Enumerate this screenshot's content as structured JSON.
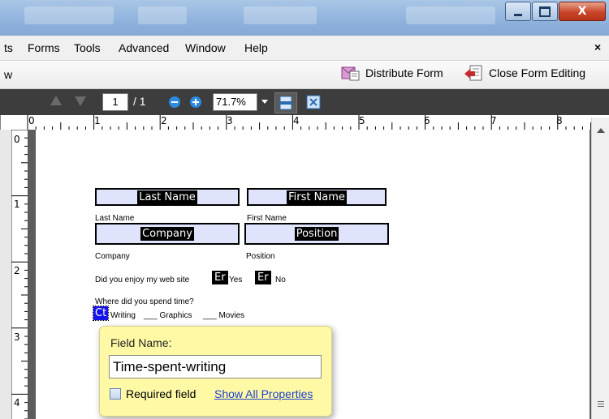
{
  "menu": {
    "items": [
      "ts",
      "Forms",
      "Tools",
      "Advanced",
      "Window",
      "Help"
    ],
    "close_glyph": "×"
  },
  "toolbar": {
    "left_fragment": "w",
    "distribute_label": "Distribute Form",
    "close_editing_label": "Close Form Editing"
  },
  "nav": {
    "page_number": "1",
    "page_total": "/ 1",
    "zoom": "71.7%"
  },
  "ruler": {
    "top_labels": [
      "0",
      "1",
      "2",
      "3",
      "4",
      "5",
      "6",
      "7",
      "8"
    ],
    "left_labels": [
      "0",
      "1",
      "2",
      "3",
      "4"
    ]
  },
  "form": {
    "last_name_field": "Last Name",
    "first_name_field": "First Name",
    "last_name_label": "Last Name",
    "first_name_label": "First Name",
    "company_field": "Company",
    "position_field": "Position",
    "company_label": "Company",
    "position_label": "Position",
    "question1": "Did you enjoy my web site",
    "radio_tag_yes": "Er",
    "yes_label": "Yes",
    "radio_tag_no": "Er",
    "no_label": "No",
    "question2": "Where did you spend time?",
    "checkbox_tag": "Ct",
    "opt_writing": "Writing",
    "opt_graphics": "___ Graphics",
    "opt_movies": "___ Movies"
  },
  "popup": {
    "title": "Field Name:",
    "field_value": "Time-spent-writing",
    "required_label": "Required field",
    "show_all_link": "Show All Properties"
  },
  "colors": {
    "field_fill": "#dfe3fb",
    "popup_bg": "#fff9a6",
    "link": "#1a3fcf",
    "nav_bg": "#3d3d3d"
  }
}
